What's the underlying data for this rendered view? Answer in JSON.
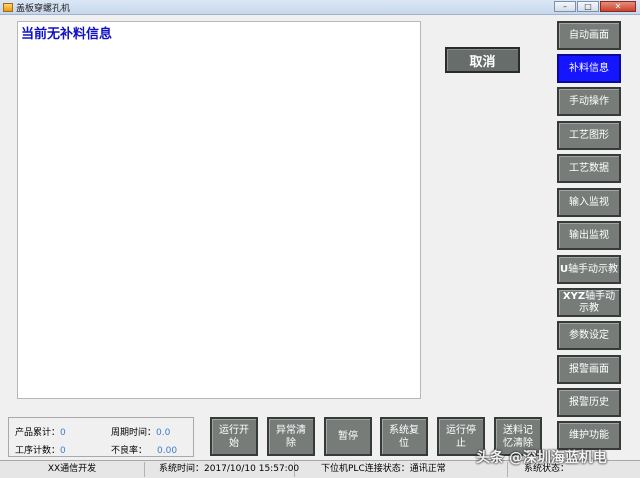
{
  "window": {
    "title": "盖板穿螺孔机",
    "minimize": "–",
    "maximize": "□",
    "close": "✕"
  },
  "info_panel": {
    "message": "当前无补料信息"
  },
  "cancel_label": "取消",
  "side_nav": [
    {
      "label": "自动画面",
      "active": false
    },
    {
      "label": "补料信息",
      "active": true
    },
    {
      "label": "手动操作",
      "active": false
    },
    {
      "label": "工艺图形",
      "active": false
    },
    {
      "label": "工艺数据",
      "active": false
    },
    {
      "label": "输入监视",
      "active": false
    },
    {
      "label": "输出监视",
      "active": false
    },
    {
      "label_prefix": "U",
      "label": "轴手动示教",
      "active": false
    },
    {
      "label_prefix": "XYZ",
      "label": "轴手动示教",
      "active": false
    },
    {
      "label": "参数设定",
      "active": false
    },
    {
      "label": "报警画面",
      "active": false
    },
    {
      "label": "报警历史",
      "active": false
    },
    {
      "label": "维护功能",
      "active": false
    }
  ],
  "stats": {
    "product_total_label": "产品累计：",
    "product_total_value": "0",
    "cycle_time_label": "周期时间：",
    "cycle_time_value": "0.0",
    "process_count_label": "工序计数：",
    "process_count_value": "0",
    "defect_rate_label": "不良率：",
    "defect_rate_value": "0.00"
  },
  "bottom_buttons": [
    {
      "line1": "运行开",
      "line2": "始"
    },
    {
      "line1": "异常清",
      "line2": "除"
    },
    {
      "line1": "暂停",
      "line2": ""
    },
    {
      "line1": "系统复",
      "line2": "位"
    },
    {
      "line1": "运行停",
      "line2": "止"
    },
    {
      "line1": "送料记",
      "line2": "忆清除"
    }
  ],
  "statusbar": {
    "developer": "XX通信开发",
    "system_time": "系统时间：2017/10/10 15:57:00",
    "plc_status": "下位机PLC连接状态：通讯正常",
    "system_status": "系统状态："
  },
  "watermark": "头条 @深圳海蓝机电"
}
